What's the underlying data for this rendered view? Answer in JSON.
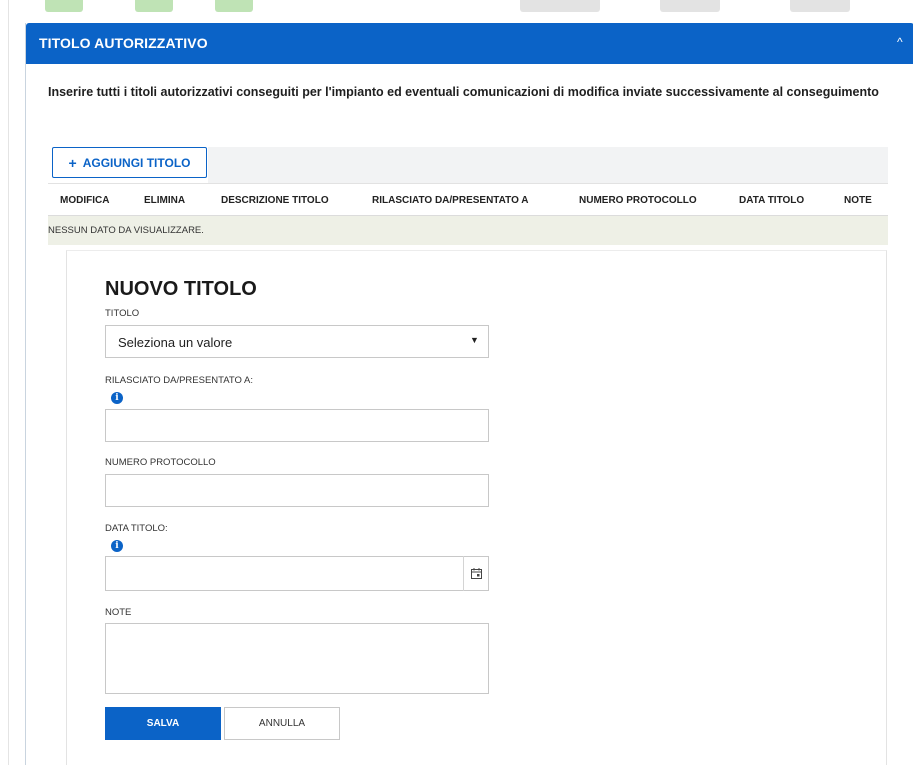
{
  "colors": {
    "primary": "#0b63c7",
    "header_text": "#ffffff",
    "empty_row_bg": "#eef0e6",
    "deco_green": "#bfe3b5",
    "deco_gray": "#e3e3e3"
  },
  "icons": {
    "collapse": "chevron-up-icon",
    "add": "plus-icon",
    "info": "info-icon",
    "calendar": "calendar-icon",
    "select_caret": "caret-down-icon"
  },
  "panel": {
    "title": "TITOLO AUTORIZZATIVO",
    "collapse_glyph": "^",
    "instructions": "Inserire tutti i titoli autorizzativi conseguiti per l'impianto ed eventuali comunicazioni di modifica inviate successivamente al conseguimento"
  },
  "toolbar": {
    "add_button_label": "AGGIUNGI TITOLO",
    "add_glyph": "+"
  },
  "table": {
    "columns": [
      "MODIFICA",
      "ELIMINA",
      "DESCRIZIONE TITOLO",
      "RILASCIATO DA/PRESENTATO A",
      "NUMERO PROTOCOLLO",
      "DATA TITOLO",
      "NOTE"
    ],
    "empty_message": "NESSUN DATO DA VISUALIZZARE."
  },
  "form": {
    "title": "NUOVO TITOLO",
    "titolo": {
      "label": "TITOLO",
      "selected_value": "Seleziona un valore",
      "caret_glyph": "▼"
    },
    "rilasciato": {
      "label": "RILASCIATO DA/PRESENTATO A:",
      "value": ""
    },
    "protocollo": {
      "label": "NUMERO PROTOCOLLO",
      "value": ""
    },
    "data_titolo": {
      "label": "DATA TITOLO:",
      "value": ""
    },
    "note": {
      "label": "NOTE",
      "value": ""
    },
    "info_glyph": "i",
    "save_label": "SALVA",
    "cancel_label": "ANNULLA"
  }
}
